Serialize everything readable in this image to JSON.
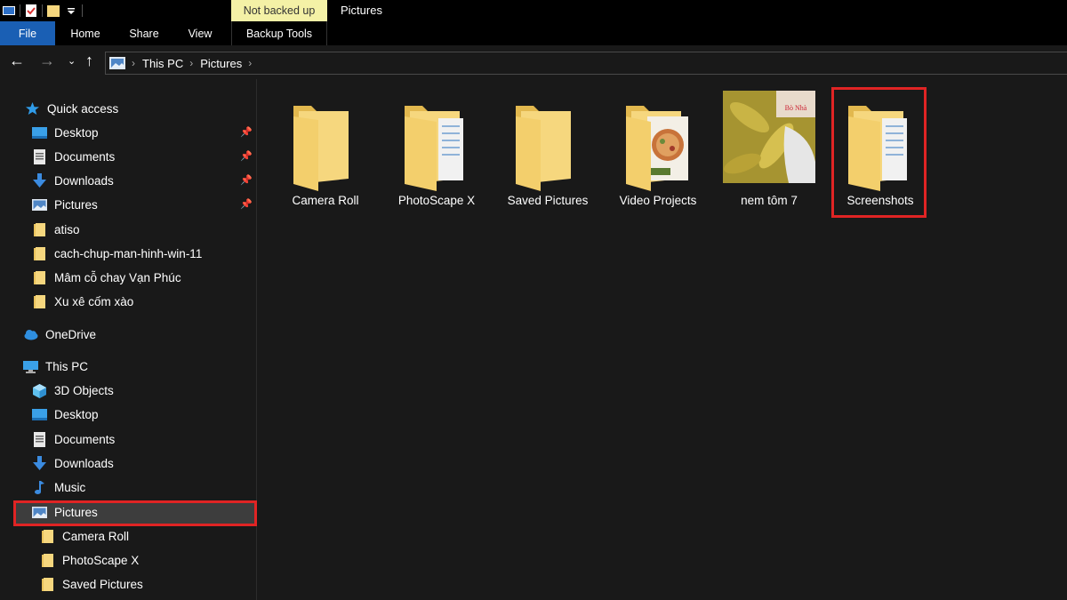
{
  "titlebar": {
    "tool_context_label": "Not backed up",
    "window_title": "Pictures"
  },
  "ribbon": {
    "tabs": [
      "File",
      "Home",
      "Share",
      "View",
      "Backup Tools"
    ]
  },
  "address_bar": {
    "breadcrumbs": [
      "This PC",
      "Pictures"
    ]
  },
  "nav_pane": {
    "quick_access": {
      "label": "Quick access",
      "items": [
        {
          "label": "Desktop",
          "icon": "desktop-icon",
          "pinned": true
        },
        {
          "label": "Documents",
          "icon": "documents-icon",
          "pinned": true
        },
        {
          "label": "Downloads",
          "icon": "downloads-icon",
          "pinned": true
        },
        {
          "label": "Pictures",
          "icon": "pictures-icon",
          "pinned": true
        },
        {
          "label": "atiso",
          "icon": "folder-icon",
          "pinned": false
        },
        {
          "label": "cach-chup-man-hinh-win-11",
          "icon": "folder-icon",
          "pinned": false
        },
        {
          "label": "Mâm cỗ chay Vạn Phúc",
          "icon": "folder-icon",
          "pinned": false
        },
        {
          "label": "Xu xê cốm xào",
          "icon": "folder-icon",
          "pinned": false
        }
      ]
    },
    "onedrive": {
      "label": "OneDrive"
    },
    "this_pc": {
      "label": "This PC",
      "items": [
        {
          "label": "3D Objects",
          "icon": "3d-objects-icon"
        },
        {
          "label": "Desktop",
          "icon": "desktop-icon"
        },
        {
          "label": "Documents",
          "icon": "documents-icon"
        },
        {
          "label": "Downloads",
          "icon": "downloads-icon"
        },
        {
          "label": "Music",
          "icon": "music-icon"
        },
        {
          "label": "Pictures",
          "icon": "pictures-icon",
          "selected": true
        }
      ],
      "pictures_children": [
        {
          "label": "Camera Roll"
        },
        {
          "label": "PhotoScape X"
        },
        {
          "label": "Saved Pictures"
        }
      ]
    }
  },
  "content": {
    "items": [
      {
        "label": "Camera Roll",
        "kind": "empty-folder"
      },
      {
        "label": "PhotoScape X",
        "kind": "folder-with-files"
      },
      {
        "label": "Saved Pictures",
        "kind": "empty-folder"
      },
      {
        "label": "Video Projects",
        "kind": "folder-with-image"
      },
      {
        "label": "nem tôm 7",
        "kind": "image",
        "thumb_text": "Bò Nhà"
      },
      {
        "label": "Screenshots",
        "kind": "folder-with-files",
        "highlighted": true
      }
    ]
  },
  "colors": {
    "background": "#191919",
    "file_tab": "#1a5fb4",
    "context_tab": "#f4f1a6",
    "highlight": "#e02424",
    "folder": "#f6d77e"
  }
}
